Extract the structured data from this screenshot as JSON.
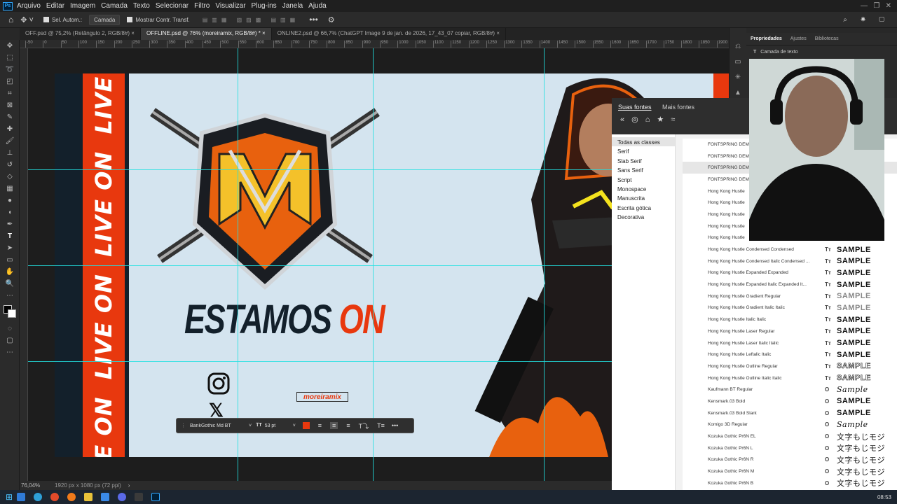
{
  "menu": [
    "Arquivo",
    "Editar",
    "Imagem",
    "Camada",
    "Texto",
    "Selecionar",
    "Filtro",
    "Visualizar",
    "Plug-ins",
    "Janela",
    "Ajuda"
  ],
  "options": {
    "auto_select": "Sel. Autom.:",
    "layer_select": "Camada",
    "show_transform": "Mostrar Contr. Transf."
  },
  "tabs": [
    {
      "label": "OFF.psd @ 75,2% (Retângulo 2, RGB/8#)"
    },
    {
      "label": "OFFLINE.psd @ 76% (moreiramix, RGB/8#) *"
    },
    {
      "label": "ONLINE2.psd @ 66,7% (ChatGPT Image 9 de jan. de 2026, 17_43_07 copiar, RGB/8#)"
    }
  ],
  "ruler_marks": [
    "-50",
    "0",
    "50",
    "100",
    "150",
    "200",
    "250",
    "300",
    "350",
    "400",
    "450",
    "500",
    "550",
    "600",
    "650",
    "700",
    "750",
    "800",
    "850",
    "900",
    "950",
    "1000",
    "1050",
    "1100",
    "1150",
    "1200",
    "1250",
    "1300",
    "1350",
    "1400",
    "1450",
    "1500",
    "1550",
    "1600",
    "1650",
    "1700",
    "1750",
    "1800",
    "1850",
    "1900"
  ],
  "artwork": {
    "banner_text": "LIVE ON",
    "headline_1": "ESTAMOS",
    "headline_2": "ON",
    "handle": "moreiramix",
    "accent": "#e8380e",
    "navy": "#13202b"
  },
  "context_bar": {
    "font": "BankGothic Md BT",
    "size": "53 pt",
    "color": "#e8380e"
  },
  "status": {
    "zoom": "76,04%",
    "doc_size": "1920 px x 1080 px (72 ppi)"
  },
  "right_panel": {
    "tabs": [
      "Propriedades",
      "Ajustes",
      "Bibliotecas"
    ],
    "layer_type": "Camada de texto"
  },
  "font_panel": {
    "tabs": [
      "Suas fontes",
      "Mais fontes"
    ],
    "categories": [
      "Todas as classes",
      "Serif",
      "Slab Serif",
      "Sans Serif",
      "Script",
      "Monospace",
      "Manuscrita",
      "Escrita gótica",
      "Decorativa"
    ],
    "fonts": [
      {
        "name": "FONTSPRING DEMO",
        "icon": "",
        "sample": ""
      },
      {
        "name": "FONTSPRING DEMO",
        "icon": "",
        "sample": ""
      },
      {
        "name": "FONTSPRING DEMO",
        "icon": "",
        "sample": ""
      },
      {
        "name": "FONTSPRING DEMO",
        "icon": "",
        "sample": ""
      },
      {
        "name": "Hong Kong Hustle",
        "icon": "",
        "sample": ""
      },
      {
        "name": "Hong Kong Hustle",
        "icon": "",
        "sample": ""
      },
      {
        "name": "Hong Kong Hustle",
        "icon": "",
        "sample": ""
      },
      {
        "name": "Hong Kong Hustle",
        "icon": "",
        "sample": ""
      },
      {
        "name": "Hong Kong Hustle",
        "icon": "",
        "sample": ""
      },
      {
        "name": "Hong Kong Hustle Condensed Condensed",
        "icon": "Tт",
        "sample": "SAMPLE"
      },
      {
        "name": "Hong Kong Hustle Condensed Italic Condensed ...",
        "icon": "Tт",
        "sample": "SAMPLE"
      },
      {
        "name": "Hong Kong Hustle Expanded Expanded",
        "icon": "Tт",
        "sample": "SAMPLE"
      },
      {
        "name": "Hong Kong Hustle Expanded Italic Expanded It...",
        "icon": "Tт",
        "sample": "SAMPLE"
      },
      {
        "name": "Hong Kong Hustle Gradient Regular",
        "icon": "Tт",
        "sample": "SAMPLE"
      },
      {
        "name": "Hong Kong Hustle Gradient Italic Italic",
        "icon": "Tт",
        "sample": "SAMPLE"
      },
      {
        "name": "Hong Kong Hustle Italic Italic",
        "icon": "Tт",
        "sample": "SAMPLE"
      },
      {
        "name": "Hong Kong Hustle Laser Regular",
        "icon": "Tт",
        "sample": "SAMPLE"
      },
      {
        "name": "Hong Kong Hustle Laser Italic Italic",
        "icon": "Tт",
        "sample": "SAMPLE"
      },
      {
        "name": "Hong Kong Hustle Leftalic Italic",
        "icon": "Tт",
        "sample": "SAMPLE"
      },
      {
        "name": "Hong Kong Hustle Outline Regular",
        "icon": "Tт",
        "sample": "SAMPLE"
      },
      {
        "name": "Hong Kong Hustle Outline Italic Italic",
        "icon": "Tт",
        "sample": "SAMPLE"
      },
      {
        "name": "Kaufmann BT Regular",
        "icon": "O",
        "sample": "Sample"
      },
      {
        "name": "Kensmark.03 Bold",
        "icon": "O",
        "sample": "SAMPLE"
      },
      {
        "name": "Kensmark.03 Bold Slant",
        "icon": "O",
        "sample": "SAMPLE"
      },
      {
        "name": "Komigo 3D Regular",
        "icon": "O",
        "sample": "Sample"
      },
      {
        "name": "Kozuka Gothic Pr6N EL",
        "icon": "O",
        "sample": "文字もじモジ"
      },
      {
        "name": "Kozuka Gothic Pr6N L",
        "icon": "O",
        "sample": "文字もじモジ"
      },
      {
        "name": "Kozuka Gothic Pr6N R",
        "icon": "O",
        "sample": "文字もじモジ"
      },
      {
        "name": "Kozuka Gothic Pr6N M",
        "icon": "O",
        "sample": "文字もじモジ"
      },
      {
        "name": "Kozuka Gothic Pr6N B",
        "icon": "O",
        "sample": "文字もじモジ"
      }
    ]
  },
  "taskbar": {
    "time": "08:53"
  }
}
